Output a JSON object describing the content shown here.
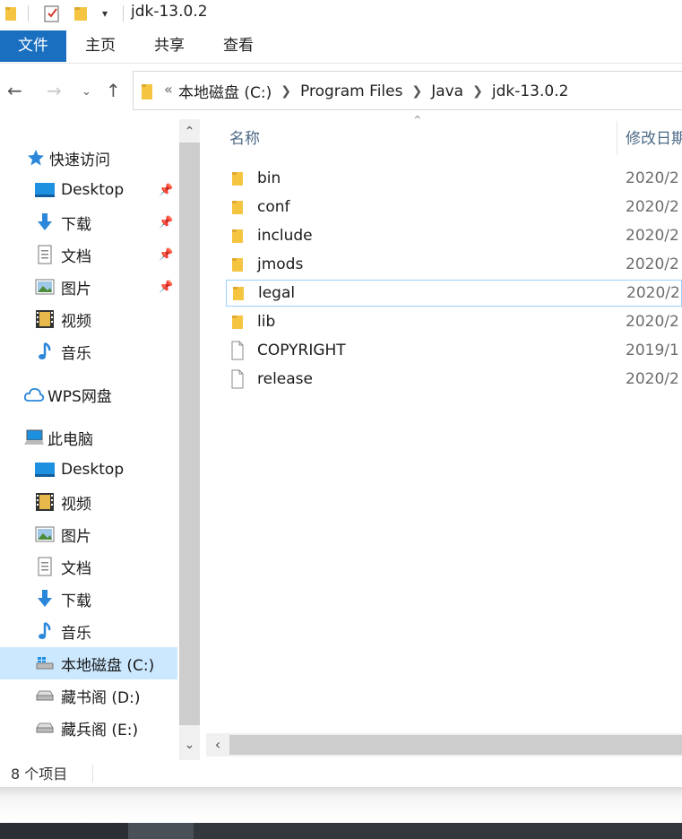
{
  "window": {
    "title": "jdk-13.0.2"
  },
  "ribbon": {
    "tabs": [
      "文件",
      "主页",
      "共享",
      "查看"
    ]
  },
  "address": {
    "overflow": "«",
    "crumbs": [
      "本地磁盘 (C:)",
      "Program Files",
      "Java",
      "jdk-13.0.2"
    ]
  },
  "columns": {
    "name": "名称",
    "date": "修改日期"
  },
  "sidebar": {
    "quick_access": "快速访问",
    "quick_items": [
      "Desktop",
      "下载",
      "文档",
      "图片",
      "视频",
      "音乐"
    ],
    "wps": "WPS网盘",
    "this_pc": "此电脑",
    "pc_items": [
      "Desktop",
      "视频",
      "图片",
      "文档",
      "下载",
      "音乐",
      "本地磁盘 (C:)",
      "藏书阁 (D:)",
      "藏兵阁 (E:)"
    ]
  },
  "files": [
    {
      "name": "bin",
      "type": "folder",
      "date": "2020/2"
    },
    {
      "name": "conf",
      "type": "folder",
      "date": "2020/2"
    },
    {
      "name": "include",
      "type": "folder",
      "date": "2020/2"
    },
    {
      "name": "jmods",
      "type": "folder",
      "date": "2020/2"
    },
    {
      "name": "legal",
      "type": "folder",
      "date": "2020/2"
    },
    {
      "name": "lib",
      "type": "folder",
      "date": "2020/2"
    },
    {
      "name": "COPYRIGHT",
      "type": "file",
      "date": "2019/1"
    },
    {
      "name": "release",
      "type": "file",
      "date": "2020/2"
    }
  ],
  "status": {
    "count": "8 个项目"
  },
  "colors": {
    "accent": "#1a6fc0",
    "folder": "#f5c542",
    "selected": "#cce8ff"
  }
}
